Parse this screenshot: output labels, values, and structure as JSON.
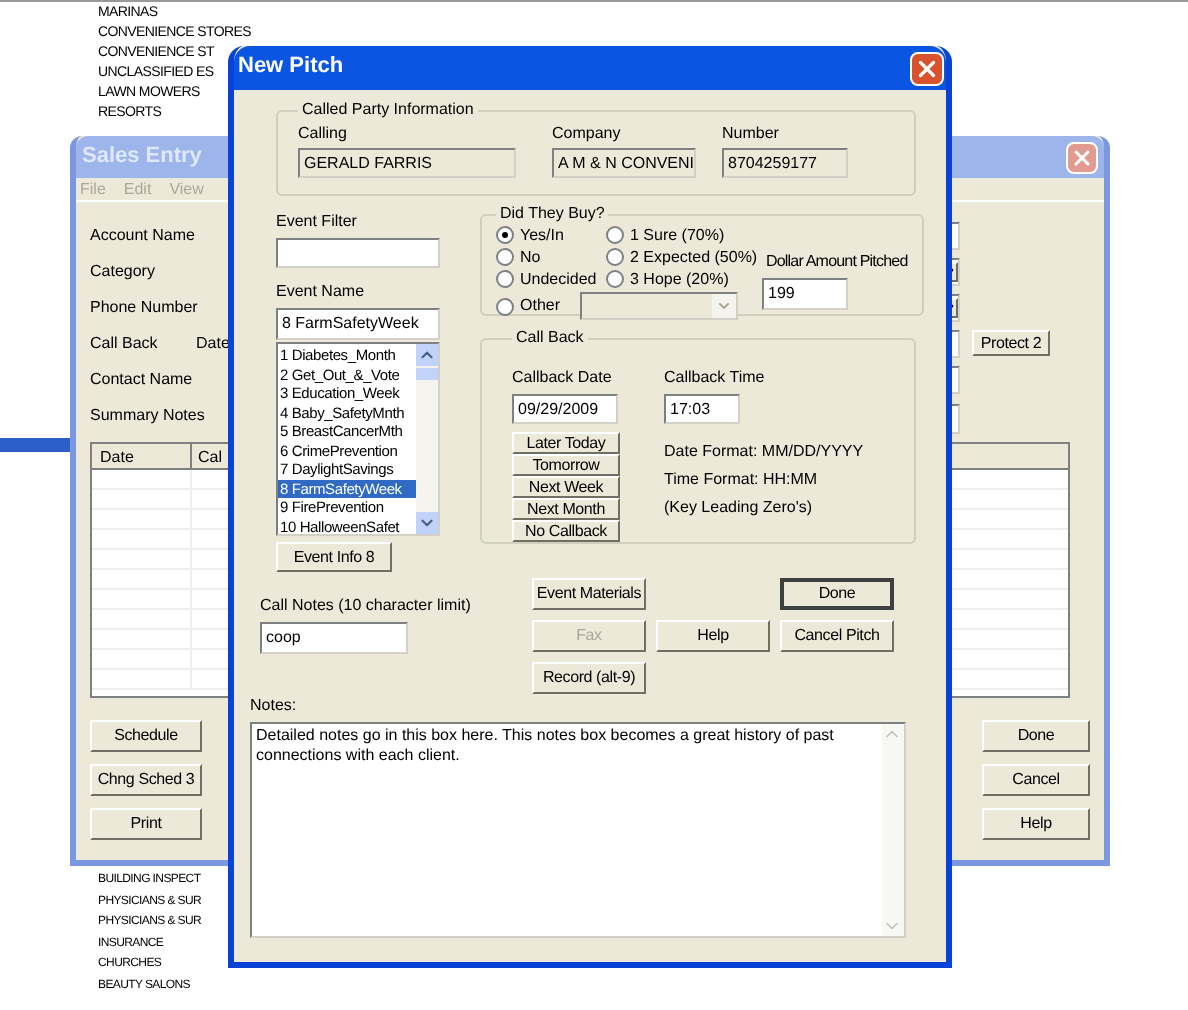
{
  "background_list_top": [
    "MARINAS",
    "CONVENIENCE STORES",
    "CONVENIENCE ST",
    "UNCLASSIFIED ES",
    "LAWN MOWERS",
    "RESORTS"
  ],
  "background_list_bottom": [
    "BUILDING INSPECT",
    "PHYSICIANS & SUR",
    "PHYSICIANS & SUR",
    "INSURANCE",
    "CHURCHES",
    "BEAUTY SALONS"
  ],
  "sales_entry": {
    "title": "Sales Entry",
    "menu": [
      "File",
      "Edit",
      "View"
    ],
    "fields": [
      {
        "label": "Account Name",
        "kind": "text"
      },
      {
        "label": "Category",
        "kind": "dropdown"
      },
      {
        "label": "Phone Number",
        "kind": "dropdown"
      },
      {
        "label": "Call Back",
        "extra": "Date",
        "kind": "protect",
        "button": "Protect 2"
      },
      {
        "label": "Contact Name",
        "kind": "text"
      },
      {
        "label": "Summary Notes",
        "kind": "text"
      }
    ],
    "table": {
      "columns": [
        "Date",
        "Cal"
      ]
    },
    "left_buttons": [
      "Schedule",
      "Chng Sched 3",
      "Print"
    ],
    "right_buttons": [
      "Done",
      "Cancel",
      "Help"
    ]
  },
  "new_pitch": {
    "title": "New Pitch",
    "called_party": {
      "title": "Called Party Information",
      "fields": [
        {
          "label": "Calling",
          "value": "GERALD FARRIS"
        },
        {
          "label": "Company",
          "value": "A M & N CONVENI"
        },
        {
          "label": "Number",
          "value": "8704259177"
        }
      ]
    },
    "event_filter": {
      "label": "Event Filter"
    },
    "event_name": {
      "label": "Event Name",
      "value": "8 FarmSafetyWeek"
    },
    "events": [
      {
        "label": "1 Diabetes_Month",
        "selected": false
      },
      {
        "label": "2 Get_Out_&_Vote",
        "selected": false
      },
      {
        "label": "3 Education_Week",
        "selected": false
      },
      {
        "label": "4 Baby_SafetyMnth",
        "selected": false
      },
      {
        "label": "5 BreastCancerMth",
        "selected": false
      },
      {
        "label": "6 CrimePrevention",
        "selected": false
      },
      {
        "label": "7 DaylightSavings",
        "selected": false
      },
      {
        "label": "8 FarmSafetyWeek",
        "selected": true
      },
      {
        "label": "9 FirePrevention",
        "selected": false
      },
      {
        "label": "10 HalloweenSafet",
        "selected": false
      }
    ],
    "event_info_button": "Event Info 8",
    "did_they_buy": {
      "title": "Did They Buy?",
      "options": [
        {
          "label": "Yes/In",
          "selected": true,
          "kind": "plain"
        },
        {
          "label": "1 Sure (70%)",
          "selected": false,
          "kind": "plain"
        },
        {
          "label": "No",
          "selected": false,
          "kind": "plain"
        },
        {
          "label": "2 Expected (50%)",
          "selected": false,
          "kind": "plain"
        },
        {
          "label": "Undecided",
          "selected": false,
          "kind": "plain"
        },
        {
          "label": "3 Hope (20%)",
          "selected": false,
          "kind": "plain"
        },
        {
          "label": "Other",
          "selected": false,
          "kind": "with_dropdown"
        }
      ],
      "other_dropdown": {
        "disabled": true
      },
      "amount_label": "Dollar Amount Pitched",
      "amount": "199"
    },
    "call_back": {
      "title": "Call Back",
      "date_label": "Callback Date",
      "date": "09/29/2009",
      "time_label": "Callback Time",
      "time": "17:03",
      "quick_buttons": [
        "Later Today",
        "Tomorrow",
        "Next Week",
        "Next Month",
        "No Callback"
      ],
      "hints": [
        "Date Format: MM/DD/YYYY",
        "Time Format: HH:MM",
        "(Key Leading Zero's)"
      ]
    },
    "call_notes": {
      "label": "Call Notes (10 character limit)",
      "value": "coop"
    },
    "button_columns": [
      [
        {
          "label": "Event Materials",
          "disabled": false,
          "default": false
        },
        {
          "label": "Fax",
          "disabled": true,
          "default": false
        },
        {
          "label": "Record (alt-9)",
          "disabled": false,
          "default": false
        }
      ],
      [
        {
          "label": "Help",
          "disabled": false,
          "default": false
        }
      ],
      [
        {
          "label": "Done",
          "disabled": false,
          "default": true
        },
        {
          "label": "Cancel Pitch",
          "disabled": false,
          "default": false
        }
      ]
    ],
    "notes": {
      "label": "Notes:",
      "value": "Detailed notes go in this box here. This notes box becomes a great history of past connections with each client."
    }
  }
}
